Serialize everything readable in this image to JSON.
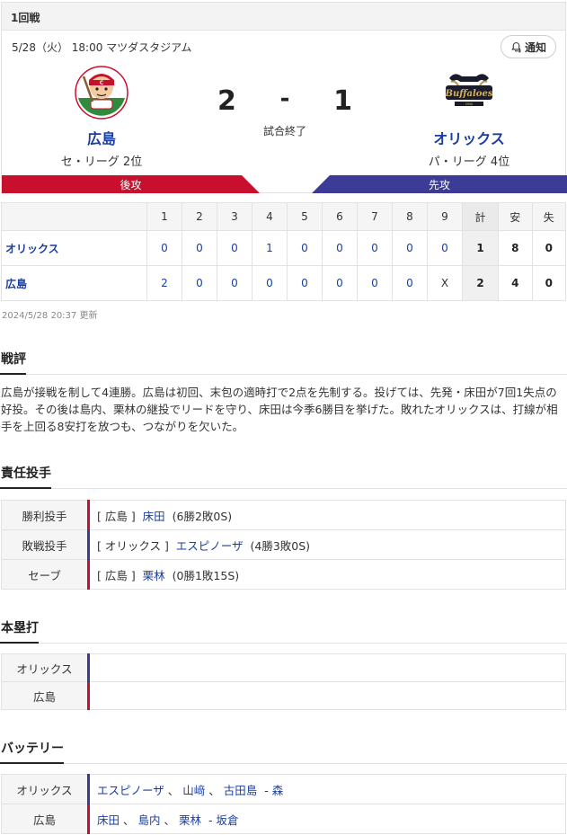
{
  "header": {
    "round": "1回戦"
  },
  "game": {
    "info": "5/28（火） 18:00 マツダスタジアム",
    "notify_label": "通知",
    "status": "試合終了",
    "home": {
      "name": "広島",
      "rank": "セ・リーグ 2位",
      "score": "2",
      "bar_label": "後攻",
      "color": "#c8102e"
    },
    "away": {
      "name": "オリックス",
      "rank": "パ・リーグ 4位",
      "score": "1",
      "bar_label": "先攻",
      "color": "#3c3c96"
    },
    "score_sep": "-"
  },
  "linescore": {
    "headers": [
      "1",
      "2",
      "3",
      "4",
      "5",
      "6",
      "7",
      "8",
      "9",
      "計",
      "安",
      "失"
    ],
    "rows": [
      {
        "team": "オリックス",
        "innings": [
          "0",
          "0",
          "0",
          "1",
          "0",
          "0",
          "0",
          "0",
          "0"
        ],
        "total": "1",
        "hits": "8",
        "errors": "0"
      },
      {
        "team": "広島",
        "innings": [
          "2",
          "0",
          "0",
          "0",
          "0",
          "0",
          "0",
          "0",
          "X"
        ],
        "total": "2",
        "hits": "4",
        "errors": "0"
      }
    ],
    "updated": "2024/5/28 20:37 更新"
  },
  "review": {
    "title": "戦評",
    "text": "広島が接戦を制して4連勝。広島は初回、末包の適時打で2点を先制する。投げては、先発・床田が7回1失点の好投。その後は島内、栗林の継投でリードを守り、床田は今季6勝目を挙げた。敗れたオリックスは、打線が相手を上回る8安打を放つも、つながりを欠いた。"
  },
  "pitchers": {
    "title": "責任投手",
    "rows": [
      {
        "label": "勝利投手",
        "team": "[ 広島 ]",
        "player": "床田",
        "record": "(6勝2敗0S)",
        "side": "home"
      },
      {
        "label": "敗戦投手",
        "team": "[ オリックス ]",
        "player": "エスピノーザ",
        "record": "(4勝3敗0S)",
        "side": "away"
      },
      {
        "label": "セーブ",
        "team": "[ 広島 ]",
        "player": "栗林",
        "record": "(0勝1敗15S)",
        "side": "home"
      }
    ]
  },
  "homeruns": {
    "title": "本塁打",
    "rows": [
      {
        "label": "オリックス",
        "side": "away"
      },
      {
        "label": "広島",
        "side": "home"
      }
    ]
  },
  "battery": {
    "title": "バッテリー",
    "rows": [
      {
        "label": "オリックス",
        "pitchers": [
          "エスピノーザ",
          "山﨑",
          "古田島"
        ],
        "catcher": "森",
        "side": "away"
      },
      {
        "label": "広島",
        "pitchers": [
          "床田",
          "島内",
          "栗林"
        ],
        "catcher": "坂倉",
        "side": "home"
      }
    ],
    "sep": "、",
    "catcher_sep": "-"
  }
}
